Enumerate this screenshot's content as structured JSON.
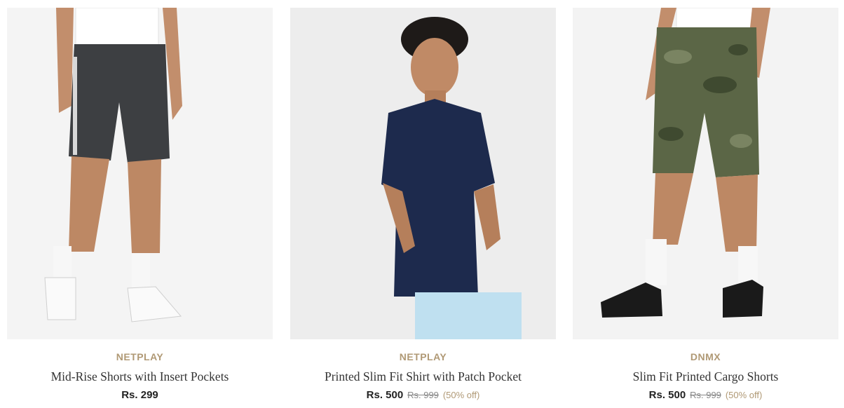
{
  "products": [
    {
      "brand": "NETPLAY",
      "name": "Mid-Rise Shorts with Insert Pockets",
      "price": "Rs. 299",
      "mrp": "",
      "discount": ""
    },
    {
      "brand": "NETPLAY",
      "name": "Printed Slim Fit Shirt with Patch Pocket",
      "price": "Rs. 500",
      "mrp": "Rs. 999",
      "discount": "(50% off)"
    },
    {
      "brand": "DNMX",
      "name": "Slim Fit Printed Cargo Shorts",
      "price": "Rs. 500",
      "mrp": "Rs. 999",
      "discount": "(50% off)"
    }
  ],
  "colors": {
    "brand": "#b09975",
    "discount": "#b09975",
    "price": "#222222",
    "name": "#333333"
  }
}
